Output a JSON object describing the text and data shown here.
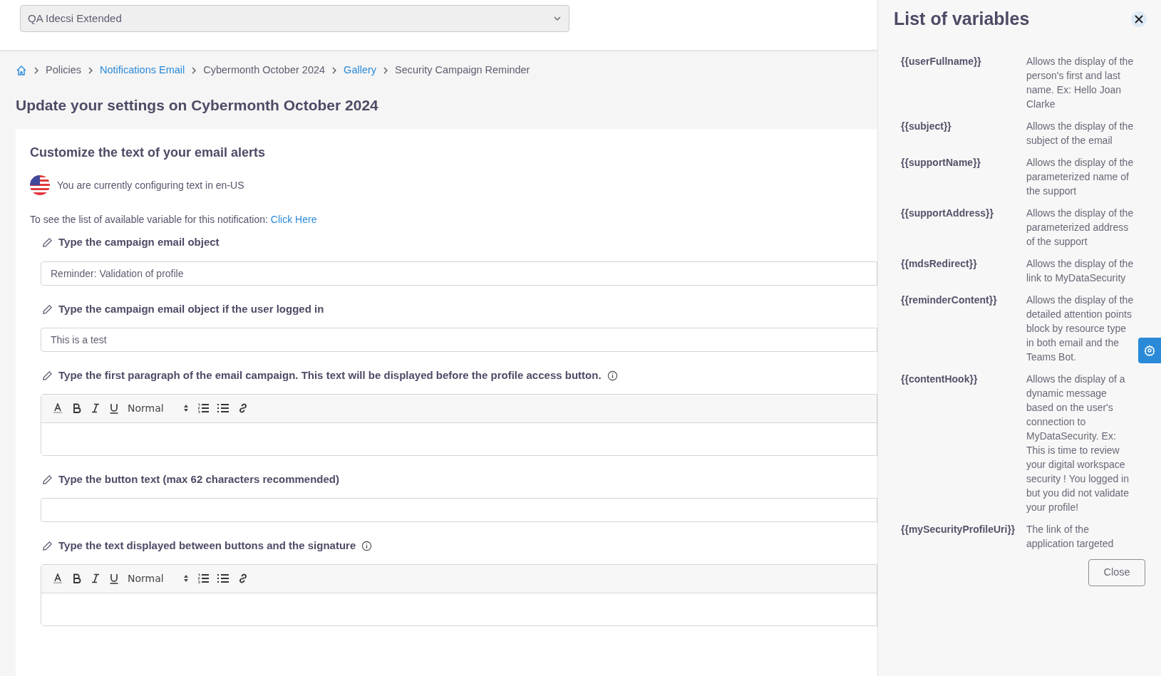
{
  "org_select": {
    "value": "QA Idecsi Extended"
  },
  "breadcrumb": [
    {
      "label": "Policies",
      "link": false
    },
    {
      "label": "Notifications Email",
      "link": true
    },
    {
      "label": "Cybermonth October 2024",
      "link": false
    },
    {
      "label": "Gallery",
      "link": true
    },
    {
      "label": "Security Campaign Reminder",
      "link": false
    }
  ],
  "page_title": "Update your settings on Cybermonth October 2024",
  "card": {
    "title": "Customize the text of your email alerts",
    "locale_note": "You are currently configuring text in en-US",
    "hint": {
      "text": "To see the list of available variable for this notification:",
      "link": "Click Here"
    },
    "fields": [
      {
        "kind": "input",
        "label": "Type the campaign email object",
        "value": "Reminder: Validation of profile",
        "info": false
      },
      {
        "kind": "input",
        "label": "Type the campaign email object if the user logged in",
        "value": "This is a test",
        "info": false
      },
      {
        "kind": "editor",
        "label": "Type the first paragraph of the email campaign. This text will be displayed before the profile access button.",
        "format": "Normal",
        "info": true
      },
      {
        "kind": "input",
        "label": "Type the button text (max 62 characters recommended)",
        "info": false
      },
      {
        "kind": "editor",
        "label": "Type the text displayed between buttons and the signature",
        "format": "Normal",
        "info": true
      }
    ]
  },
  "panel": {
    "title": "List of variables",
    "variables": [
      {
        "name": "{{userFullname}}",
        "description": "Allows the display of the person's first and last name. Ex: Hello Joan Clarke"
      },
      {
        "name": "{{subject}}",
        "description": "Allows the display of the subject of the email"
      },
      {
        "name": "{{supportName}}",
        "description": "Allows the display of the parameterized name of the support"
      },
      {
        "name": "{{supportAddress}}",
        "description": "Allows the display of the parameterized address of the support"
      },
      {
        "name": "{{mdsRedirect}}",
        "description": "Allows the display of the link to MyDataSecurity"
      },
      {
        "name": "{{reminderContent}}",
        "description": "Allows the display of the detailed attention points block by resource type in both email and the Teams Bot."
      },
      {
        "name": "{{contentHook}}",
        "description": "Allows the display of a dynamic message based on the user's connection to MyDataSecurity. Ex: This is time to review your digital workspace security ! You logged in but you did not validate your profile!"
      },
      {
        "name": "{{mySecurityProfileUri}}",
        "description": "The link of the application targeted"
      }
    ],
    "close_button": "Close"
  }
}
